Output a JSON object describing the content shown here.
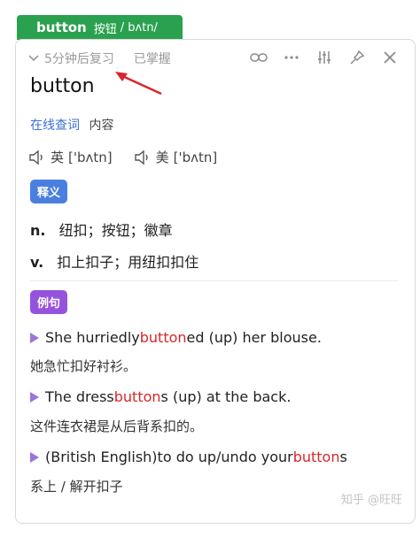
{
  "tag": {
    "word": "button",
    "pos_label": "按钮",
    "phonetic": "/ bʌtn/"
  },
  "review": {
    "schedule": "5分钟后复习",
    "mastered": "已掌握"
  },
  "toolbar_icons": [
    "link-icon",
    "more-icon",
    "settings-sliders-icon",
    "pin-icon",
    "close-icon"
  ],
  "headword": "button",
  "query": {
    "online": "在线查词",
    "content": "内容"
  },
  "pronunciations": [
    {
      "region": "英",
      "ipa": "['bʌtn]"
    },
    {
      "region": "美",
      "ipa": "['bʌtn]"
    }
  ],
  "definitions_label": "释义",
  "definitions": [
    {
      "pos": "n.",
      "meaning": "纽扣；按钮；徽章"
    },
    {
      "pos": "v.",
      "meaning": "扣上扣子；用纽扣扣住"
    }
  ],
  "examples_label": "例句",
  "examples": [
    {
      "pre": "She hurriedly ",
      "hl": "button",
      "post": "ed (up) her blouse.",
      "zh": "她急忙扣好衬衫。"
    },
    {
      "pre": "The dress ",
      "hl": "button",
      "post": "s (up) at the back.",
      "zh": "这件连衣裙是从后背系扣的。"
    },
    {
      "pre": "(British English)to do up/undo your ",
      "hl": "button",
      "post": "s",
      "zh": "系上 / 解开扣子"
    }
  ],
  "watermark": "知乎 @旺旺",
  "colors": {
    "tag_green": "#2aa14e",
    "link_blue": "#3b6fd3",
    "badge_blue": "#4a7fe0",
    "badge_purple": "#9553dd",
    "highlight_red": "#d8262b"
  }
}
